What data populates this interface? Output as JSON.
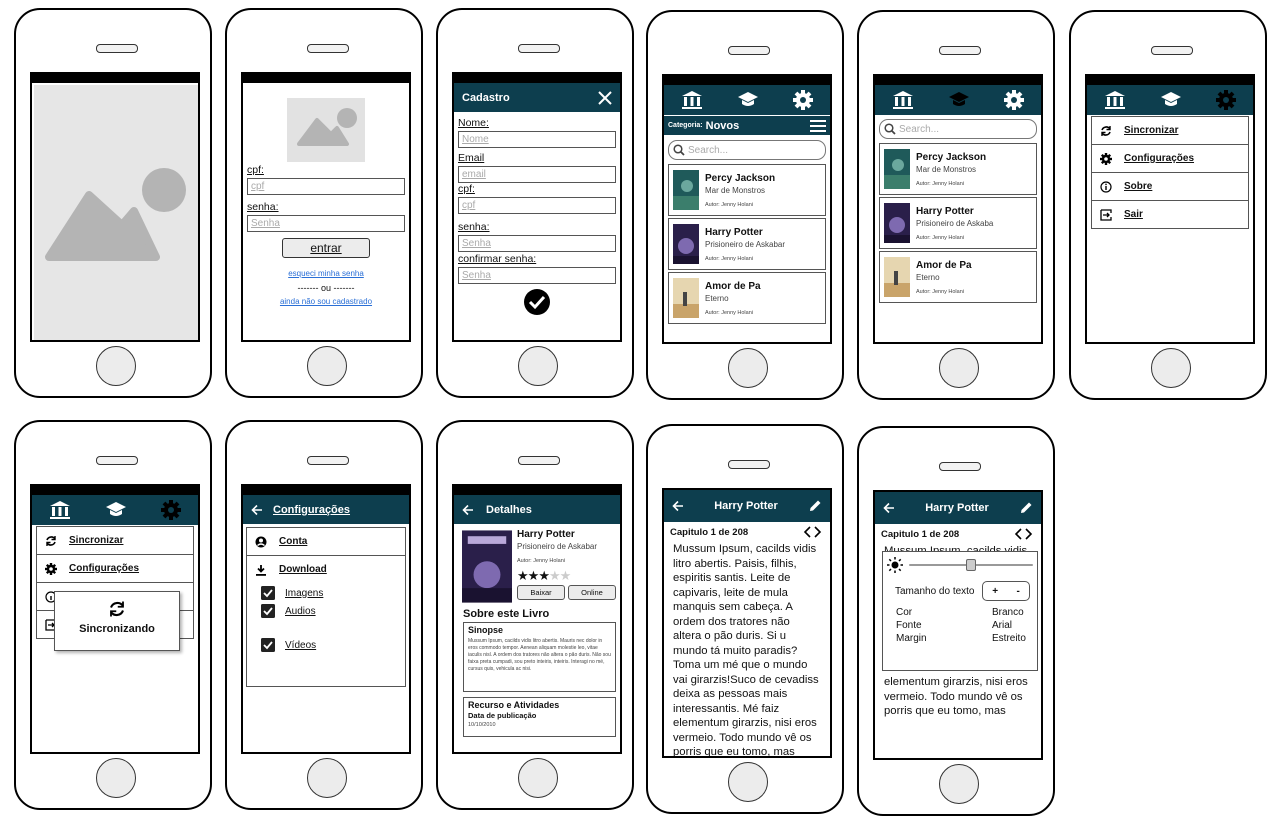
{
  "login": {
    "cpf_label": "cpf:",
    "cpf_placeholder": "cpf",
    "senha_label": "senha:",
    "senha_placeholder": "Senha",
    "enter_button": "entrar",
    "forgot_link": "esqueci minha senha",
    "or_separator": "------- ou -------",
    "register_link": "ainda não sou cadastrado"
  },
  "cadastro": {
    "title": "Cadastro",
    "nome_label": "Nome:",
    "nome_placeholder": "Nome",
    "email_label": "Email",
    "email_placeholder": "email",
    "cpf_label": "cpf:",
    "cpf_placeholder": "cpf",
    "senha_label": "senha:",
    "senha_placeholder": "Senha",
    "confirm_label": "confirmar senha:",
    "confirm_placeholder": "Senha"
  },
  "library": {
    "category_label": "Categoria:",
    "category_value": "Novos",
    "search_placeholder": "Search...",
    "books": [
      {
        "title": "Percy Jackson",
        "subtitle": "Mar de Monstros",
        "author": "Autor: Jenny Holani"
      },
      {
        "title": "Harry Potter",
        "subtitle": "Prisioneiro de Askabar",
        "author": "Autor: Jenny Holani"
      },
      {
        "title": "Amor de Pa",
        "subtitle": "Eterno",
        "author": "Autor: Jenny Holani"
      }
    ],
    "books_b": [
      {
        "title": "Percy Jackson",
        "subtitle": "Mar de Monstros",
        "author": "Autor: Jenny Holani"
      },
      {
        "title": "Harry Potter",
        "subtitle": "Prisioneiro de Askaba",
        "author": "Autor: Jenny Holani"
      },
      {
        "title": "Amor de Pa",
        "subtitle": "Eterno",
        "author": "Autor: Jenny Holani"
      }
    ]
  },
  "menu": {
    "sync": "Sincronizar",
    "settings": "Configurações",
    "about": "Sobre",
    "logout": "Sair",
    "syncing": "Sincronizando"
  },
  "config": {
    "title": "Configurações",
    "account": "Conta",
    "download": "Download",
    "images": "Imagens",
    "audios": "Audios",
    "videos": "Vídeos"
  },
  "details": {
    "title": "Detalhes",
    "book_title": "Harry Potter",
    "book_subtitle": "Prisioneiro de Askabar",
    "author": "Autor: Jenny Holani",
    "rating": 3,
    "rating_max": 5,
    "download_button": "Baixar",
    "online_button": "Online",
    "about_heading": "Sobre este Livro",
    "synopsis_heading": "Sinopse",
    "synopsis_text": "Mussum Ipsum, cacilds vidis litro abertis. Mauris nec dolor in eros commodo tempor. Aenean aliquam molestie leo, vitae iaculis nisl. A ordem dos tratores não altera o pão duris. Não sou faixa preta cumpadi, sou preto inteiris, inteiris. Interagi no mé, cursus quis, vehicula ac nisi.",
    "resources_heading": "Recurso e Atividades",
    "pub_date_label": "Data de publicação",
    "pub_date": "10/10/2010"
  },
  "reader": {
    "title": "Harry Potter",
    "chapter": "Capitulo 1 de 208",
    "text": "Mussum Ipsum, cacilds vidis litro abertis. Paisis, filhis, espiritis santis. Leite de capivaris, leite de mula manquis sem cabeça. A ordem dos tratores não altera o pão duris. Si u mundo tá muito paradis? Toma um mé que o mundo vai girarzis!Suco de cevadiss deixa as pessoas mais interessantis. Mé faiz elementum girarzis, nisi eros vermeio. Todo mundo vê os porris que eu tomo, mas",
    "text_top": "Mussum Ipsum, cacilds vidis litro abertis. Paisis, filhis,",
    "text_bottom": "elementum girarzis, nisi eros vermeio. Todo mundo vê os porris que eu tomo, mas",
    "font_size_label": "Tamanho do texto",
    "plus": "+",
    "minus": "-",
    "cor_label": "Cor",
    "cor_value": "Branco",
    "fonte_label": "Fonte",
    "fonte_value": "Arial",
    "margin_label": "Margin",
    "margin_value": "Estreito",
    "brightness": 0.5
  },
  "colors": {
    "header": "#0d3e4e",
    "link": "#2a6fd6"
  }
}
